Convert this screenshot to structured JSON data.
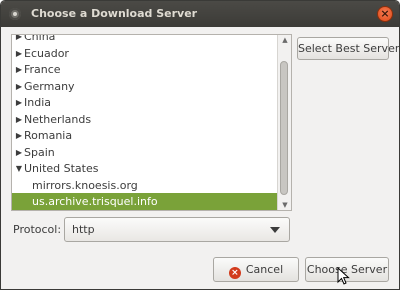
{
  "window": {
    "title": "Choose a Download Server"
  },
  "server_list": {
    "items": [
      {
        "label": "China",
        "expander": "collapsed-arrow-icon"
      },
      {
        "label": "Ecuador",
        "expander": "collapsed-arrow-icon"
      },
      {
        "label": "France",
        "expander": "collapsed-arrow-icon"
      },
      {
        "label": "Germany",
        "expander": "collapsed-arrow-icon"
      },
      {
        "label": "India",
        "expander": "collapsed-arrow-icon"
      },
      {
        "label": "Netherlands",
        "expander": "collapsed-arrow-icon"
      },
      {
        "label": "Romania",
        "expander": "collapsed-arrow-icon"
      },
      {
        "label": "Spain",
        "expander": "collapsed-arrow-icon"
      },
      {
        "label": "United States",
        "expander": "expanded-arrow-icon"
      },
      {
        "label": "mirrors.knoesis.org"
      },
      {
        "label": "us.archive.trisquel.info",
        "selected": true
      }
    ]
  },
  "buttons": {
    "select_best": "Select Best Server",
    "cancel": "Cancel",
    "choose": "Choose Server"
  },
  "protocol": {
    "label": "Protocol:",
    "value": "http"
  },
  "colors": {
    "selection": "#7aa239",
    "titlebar": "#3c3b37",
    "close": "#df4a16"
  }
}
